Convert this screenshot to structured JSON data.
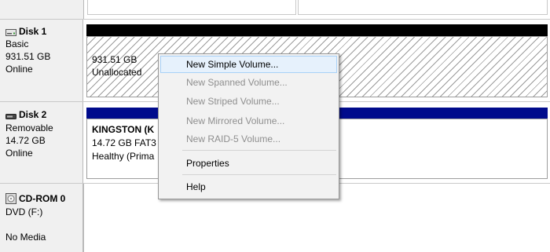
{
  "disks": [
    {
      "title": "Disk 1",
      "type": "Basic",
      "size": "931.51 GB",
      "status": "Online",
      "icon": "hard-disk-icon",
      "partition": {
        "size": "931.51 GB",
        "status": "Unallocated"
      }
    },
    {
      "title": "Disk 2",
      "type": "Removable",
      "size": "14.72 GB",
      "status": "Online",
      "icon": "removable-disk-icon",
      "partition": {
        "name": "KINGSTON  (K",
        "details": "14.72 GB FAT3",
        "status": "Healthy (Prima"
      }
    },
    {
      "title": "CD-ROM 0",
      "type": "DVD (F:)",
      "status": "No Media",
      "icon": "cd-rom-icon"
    }
  ],
  "context_menu": {
    "items": [
      {
        "label": "New Simple Volume...",
        "enabled": true,
        "highlighted": true
      },
      {
        "label": "New Spanned Volume...",
        "enabled": false
      },
      {
        "label": "New Striped Volume...",
        "enabled": false
      },
      {
        "label": "New Mirrored Volume...",
        "enabled": false
      },
      {
        "label": "New RAID-5 Volume...",
        "enabled": false
      },
      {
        "label": "Properties",
        "enabled": true
      },
      {
        "label": "Help",
        "enabled": true
      }
    ]
  },
  "colors": {
    "unallocated_bar": "#000000",
    "primary_partition_bar": "#000b8c",
    "menu_highlight": "#e6f1fc",
    "disabled_text": "#8f8f8f"
  }
}
